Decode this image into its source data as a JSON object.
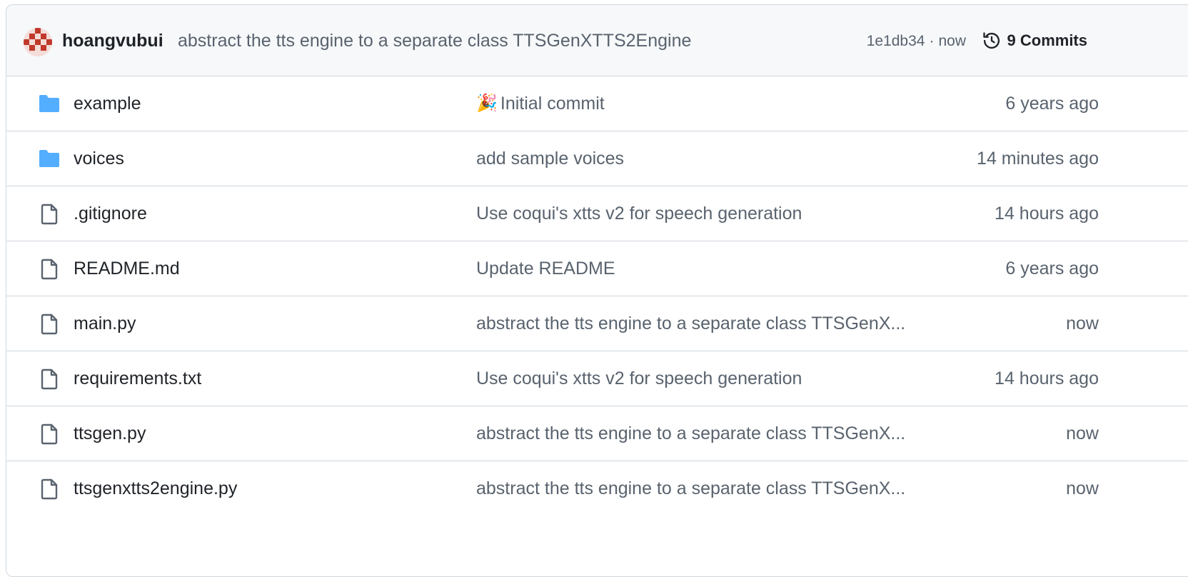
{
  "latest_commit": {
    "author": "hoangvubui",
    "message": "abstract the tts engine to a separate class TTSGenXTTS2Engine",
    "sha": "1e1db34",
    "time": "now",
    "commits_label": "9 Commits"
  },
  "files": [
    {
      "name": "example",
      "type": "folder",
      "message": "Initial commit",
      "emoji": "🎉",
      "time": "6 years ago"
    },
    {
      "name": "voices",
      "type": "folder",
      "message": "add sample voices",
      "emoji": "",
      "time": "14 minutes ago"
    },
    {
      "name": ".gitignore",
      "type": "file",
      "message": "Use coqui's xtts v2 for speech generation",
      "emoji": "",
      "time": "14 hours ago"
    },
    {
      "name": "README.md",
      "type": "file",
      "message": "Update README",
      "emoji": "",
      "time": "6 years ago"
    },
    {
      "name": "main.py",
      "type": "file",
      "message": "abstract the tts engine to a separate class TTSGenX...",
      "emoji": "",
      "time": "now"
    },
    {
      "name": "requirements.txt",
      "type": "file",
      "message": "Use coqui's xtts v2 for speech generation",
      "emoji": "",
      "time": "14 hours ago"
    },
    {
      "name": "ttsgen.py",
      "type": "file",
      "message": "abstract the tts engine to a separate class TTSGenX...",
      "emoji": "",
      "time": "now"
    },
    {
      "name": "ttsgenxtts2engine.py",
      "type": "file",
      "message": "abstract the tts engine to a separate class TTSGenX...",
      "emoji": "",
      "time": "now"
    }
  ],
  "colors": {
    "folder": "#54aeff",
    "file_icon": "#59636e",
    "header_bg": "#f6f8fa",
    "border": "#d0d7de"
  },
  "icons": {
    "folder": "folder-icon",
    "file": "file-icon",
    "history": "history-icon"
  }
}
